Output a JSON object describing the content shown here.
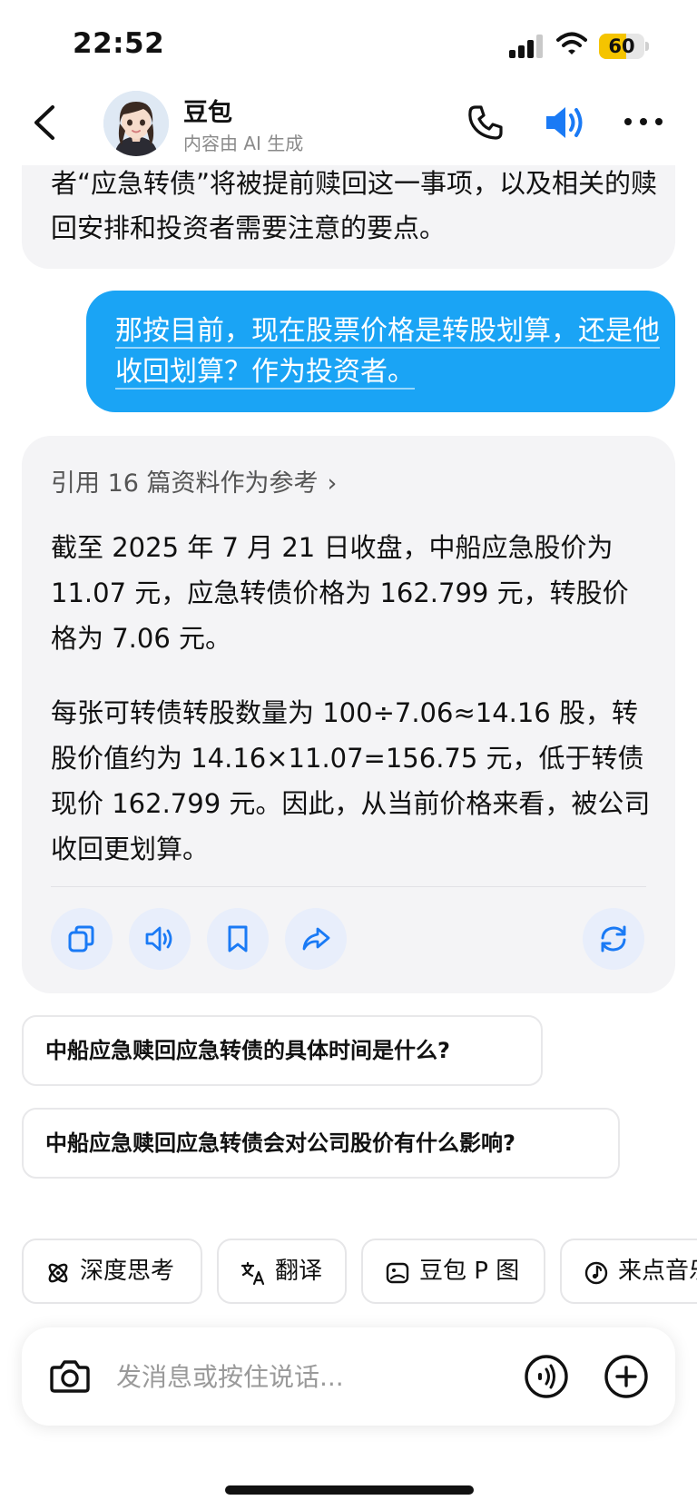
{
  "status_bar": {
    "time": "22:52",
    "battery": "60",
    "battery_level": 0.6
  },
  "header": {
    "name": "豆包",
    "subtitle": "内容由 AI 生成"
  },
  "messages": {
    "bot_prev_text": "者“应急转债”将被提前赎回这一事项，以及相关的赎回安排和投资者需要注意的要点。",
    "user_text": "那按目前，现在股票价格是转股划算，还是他收回划算？作为投资者。",
    "bot_refs": "引用 16 篇资料作为参考",
    "bot_para1": "截至 2025 年 7 月 21 日收盘，中船应急股价为 11.07 元，应急转债价格为 162.799 元，转股价格为 7.06 元。",
    "bot_para2": "每张可转债转股数量为 100÷7.06≈14.16 股，转股价值约为 14.16×11.07=156.75 元，低于转债现价 162.799 元。因此，从当前价格来看，被公司收回更划算。"
  },
  "actions": [
    "copy-icon",
    "speaker-icon",
    "bookmark-icon",
    "share-icon",
    "regenerate-icon"
  ],
  "suggestions": [
    "中船应急赎回应急转债的具体时间是什么?",
    "中船应急赎回应急转债会对公司股价有什么影响?"
  ],
  "chips": [
    "深度思考",
    "翻译",
    "豆包 P 图",
    "来点音乐"
  ],
  "input": {
    "placeholder": "发消息或按住说话..."
  },
  "colors": {
    "accent": "#1aa4f5",
    "icon_blue": "#1a7af5",
    "bubble_gray": "#f4f4f6",
    "battery": "#f5c400"
  }
}
